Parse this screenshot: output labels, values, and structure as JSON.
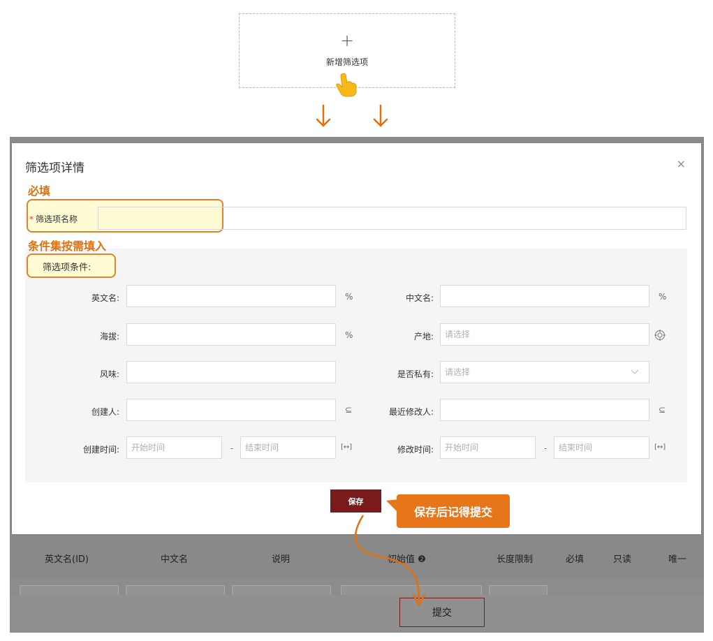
{
  "add_card": {
    "plus": "+",
    "label": "新增筛选项"
  },
  "dialog": {
    "title": "筛选项详情",
    "close": "×",
    "annotation_required": "必填",
    "name_label_star": "*",
    "name_label": "筛选项名称",
    "annotation_conditions": "条件集按需填入",
    "conditions_title": "筛选项条件:",
    "fields": {
      "english_name": {
        "label": "英文名:",
        "suffix": "%"
      },
      "chinese_name": {
        "label": "中文名:",
        "suffix": "%"
      },
      "altitude": {
        "label": "海拔:",
        "suffix": "%"
      },
      "origin": {
        "label": "产地:",
        "placeholder": "请选择"
      },
      "flavor": {
        "label": "风味:"
      },
      "is_private": {
        "label": "是否私有:",
        "placeholder": "请选择"
      },
      "creator": {
        "label": "创建人:",
        "suffix": "⊆"
      },
      "last_modifier": {
        "label": "最近修改人:",
        "suffix": "⊆"
      },
      "created_time": {
        "label": "创建时间:",
        "start": "开始时间",
        "dash": "-",
        "end": "结束时间",
        "suffix": "[↔]"
      },
      "modified_time": {
        "label": "修改时间:",
        "start": "开始时间",
        "dash": "-",
        "end": "结束时间",
        "suffix": "[↔]"
      }
    },
    "save_button": "保存",
    "callout": "保存后记得提交"
  },
  "background": {
    "columns": [
      "英文名(ID)",
      "中文名",
      "说明",
      "初始值 ❷",
      "长度限制",
      "必填",
      "只读",
      "唯一"
    ],
    "submit_button": "提交"
  },
  "colors": {
    "accent_orange": "#e0700e",
    "brand_red": "#7a1a1a",
    "highlight_yellow": "#fdfbd4"
  }
}
